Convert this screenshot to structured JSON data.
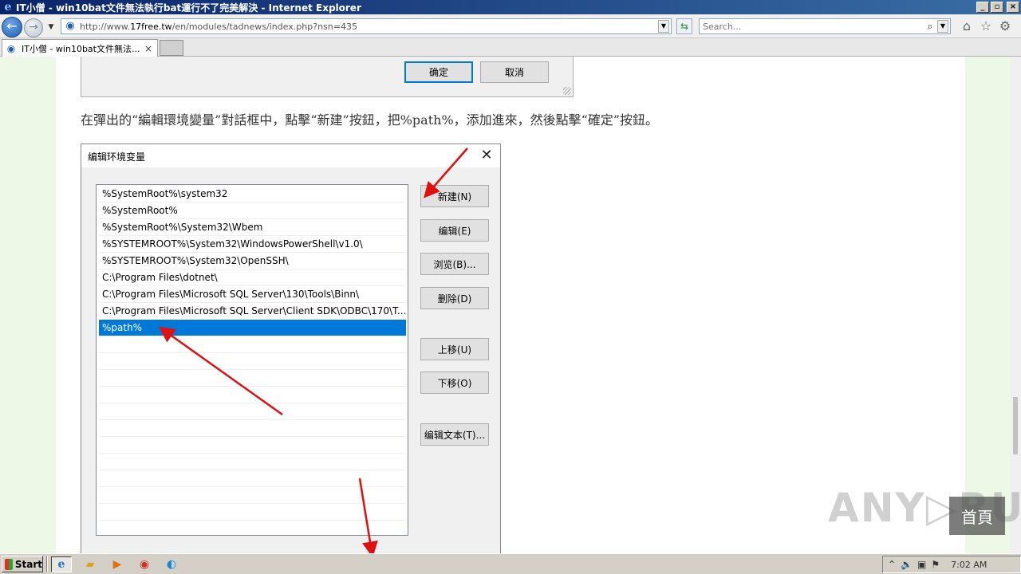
{
  "window": {
    "title": "IT小僧 - win10bat文件無法執行bat運行不了完美解決 - Internet Explorer",
    "min": "_",
    "max": "▫",
    "close": "×"
  },
  "toolbar": {
    "url_prefix": "http://www.",
    "url_domain": "17free.tw",
    "url_rest": "/en/modules/tadnews/index.php?nsn=435",
    "search_placeholder": "Search..."
  },
  "tabs": [
    {
      "label": "IT小僧 - win10bat文件無法..."
    }
  ],
  "prev_dialog": {
    "ok_label": "确定",
    "cancel_label": "取消"
  },
  "article": {
    "paragraph": "在彈出的“編輯環境變量”對話框中，點擊“新建”按鈕，把%path%，添加進來，然後點擊“確定”按鈕。"
  },
  "env_dialog": {
    "title": "编辑环境变量",
    "close": "✕",
    "entries": [
      "%SystemRoot%\\system32",
      "%SystemRoot%",
      "%SystemRoot%\\System32\\Wbem",
      "%SYSTEMROOT%\\System32\\WindowsPowerShell\\v1.0\\",
      "%SYSTEMROOT%\\System32\\OpenSSH\\",
      "C:\\Program Files\\dotnet\\",
      "C:\\Program Files\\Microsoft SQL Server\\130\\Tools\\Binn\\",
      "C:\\Program Files\\Microsoft SQL Server\\Client SDK\\ODBC\\170\\T...",
      "%path%"
    ],
    "selected_entry": "%path%",
    "buttons": {
      "new": "新建(N)",
      "edit": "编辑(E)",
      "browse": "浏览(B)...",
      "delete": "删除(D)",
      "move_up": "上移(U)",
      "move_down": "下移(O)",
      "edit_text": "编辑文本(T)..."
    }
  },
  "watermark": {
    "text": "ANY▷RUN",
    "home": "首頁"
  },
  "taskbar": {
    "start": "Start",
    "clock": "7:02 AM"
  }
}
